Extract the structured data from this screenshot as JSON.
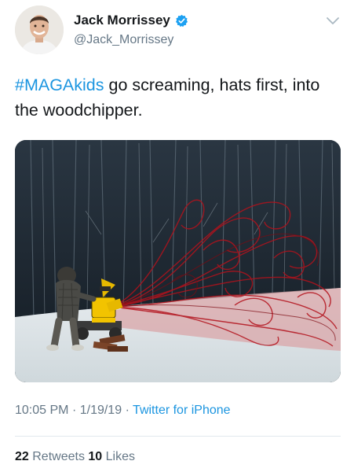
{
  "author": {
    "display_name": "Jack Morrissey",
    "handle": "@Jack_Morrissey",
    "verified": true
  },
  "tweet": {
    "hashtag": "#MAGAkids",
    "text": " go screaming, hats first, into the woodchipper."
  },
  "meta": {
    "time": "10:05 PM",
    "date": "1/19/19",
    "separator": "·",
    "source": "Twitter for iPhone"
  },
  "stats": {
    "retweets_count": "22",
    "retweets_label": "Retweets",
    "likes_count": "10",
    "likes_label": "Likes"
  },
  "colors": {
    "link": "#1b95e0",
    "secondary_text": "#657786",
    "primary_text": "#14171a",
    "blood_red": "#b3121c"
  },
  "icons": {
    "verified": "verified-badge-icon",
    "more": "chevron-down-icon"
  }
}
